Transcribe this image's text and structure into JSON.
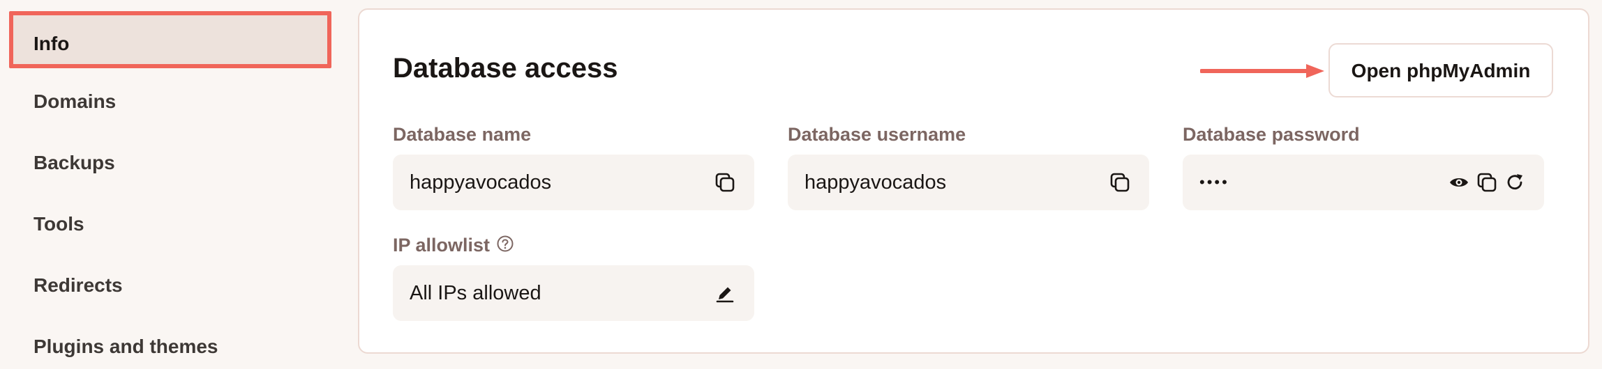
{
  "sidebar": {
    "items": [
      {
        "label": "Info",
        "active": true
      },
      {
        "label": "Domains"
      },
      {
        "label": "Backups"
      },
      {
        "label": "Tools"
      },
      {
        "label": "Redirects"
      },
      {
        "label": "Plugins and themes"
      }
    ]
  },
  "panel": {
    "title": "Database access",
    "open_button": "Open phpMyAdmin",
    "fields": {
      "db_name": {
        "label": "Database name",
        "value": "happyavocados"
      },
      "db_username": {
        "label": "Database username",
        "value": "happyavocados"
      },
      "db_password": {
        "label": "Database password",
        "value": "••••"
      },
      "ip_allowlist": {
        "label": "IP allowlist",
        "value": "All IPs allowed"
      }
    }
  },
  "colors": {
    "accent": "#f0655a",
    "label": "#7c6662",
    "field_bg": "#f7f3f0"
  },
  "icons": [
    "copy-icon",
    "eye-icon",
    "refresh-icon",
    "edit-icon",
    "help-icon",
    "arrow-icon"
  ]
}
